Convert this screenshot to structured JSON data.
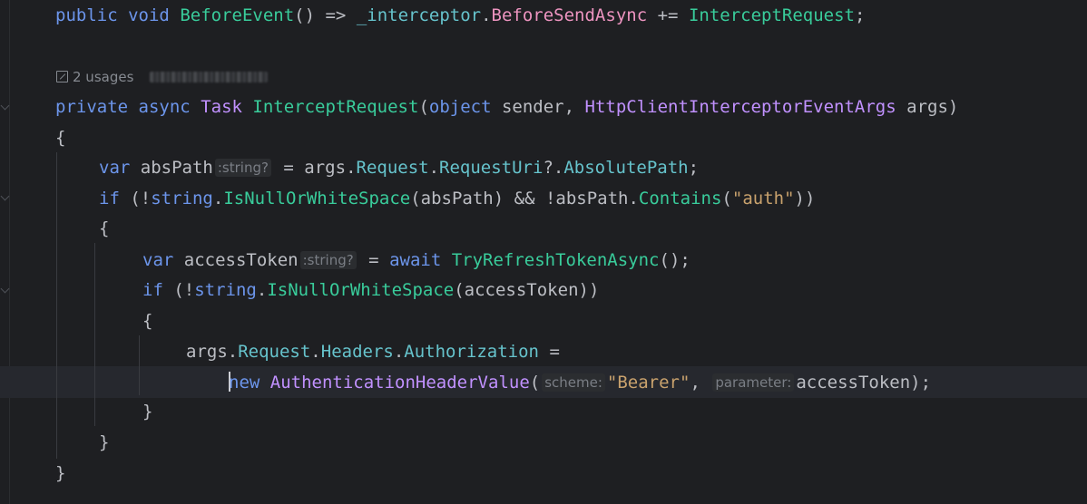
{
  "editor": {
    "lines": {
      "l1": {
        "kw_public": "public",
        "kw_void": "void",
        "name": "BeforeEvent",
        "parens": "() =>",
        "field": "_interceptor",
        "dot": ".",
        "event": "BeforeSendAsync",
        "op": "+=",
        "handler": "InterceptRequest",
        "end": ";"
      },
      "usages": {
        "text": "2 usages"
      },
      "l2": {
        "kw_private": "private",
        "kw_async": "async",
        "type_task": "Task",
        "name": "InterceptRequest",
        "open": "(",
        "kw_object": "object",
        "p1": "sender,",
        "type_args": "HttpClientInterceptorEventArgs",
        "p2": "args)"
      },
      "l3": {
        "brace": "{"
      },
      "l4": {
        "kw_var": "var",
        "var_name": "absPath",
        "hint": ":string?",
        "eq": "=",
        "args": "args",
        "d1": ".",
        "request": "Request",
        "d2": ".",
        "requesturi": "RequestUri",
        "d3": "?.",
        "abspath": "AbsolutePath",
        "end": ";"
      },
      "l5": {
        "kw_if": "if",
        "open": "(!",
        "kw_string": "string",
        "dot": ".",
        "method": "IsNullOrWhiteSpace",
        "arg": "(absPath) && !absPath.",
        "contains": "Contains",
        "po": "(",
        "str": "\"auth\"",
        "pc": "))"
      },
      "l6": {
        "brace": "{"
      },
      "l7": {
        "kw_var": "var",
        "var_name": "accessToken",
        "hint": ":string?",
        "eq": "=",
        "kw_await": "await",
        "method": "TryRefreshTokenAsync",
        "end": "();"
      },
      "l8": {
        "kw_if": "if",
        "open": "(!",
        "kw_string": "string",
        "dot": ".",
        "method": "IsNullOrWhiteSpace",
        "arg": "(accessToken))"
      },
      "l9": {
        "brace": "{"
      },
      "l10": {
        "args": "args",
        "d1": ".",
        "request": "Request",
        "d2": ".",
        "headers": "Headers",
        "d3": ".",
        "authorization": "Authorization",
        "eq": "="
      },
      "l11": {
        "kw_new": "new",
        "type": "AuthenticationHeaderValue",
        "open": "(",
        "hint1": "scheme:",
        "str": "\"Bearer\"",
        "comma": ",",
        "hint2": "parameter:",
        "arg": "accessToken);"
      },
      "l12": {
        "brace": "}"
      },
      "l13": {
        "brace": "}"
      },
      "l14": {
        "brace": "}"
      }
    }
  }
}
